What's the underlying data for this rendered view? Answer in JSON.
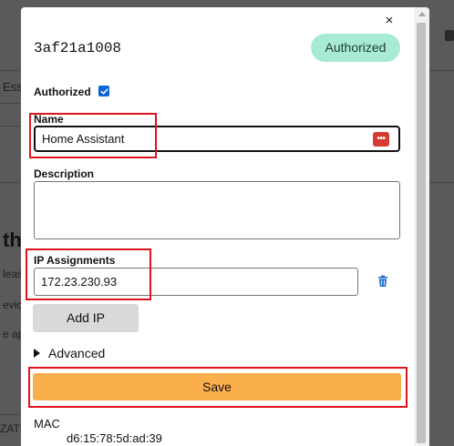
{
  "background_page": {
    "fragments": [
      "Ess",
      "th",
      "leas",
      "evic",
      "e ap",
      "ZATI"
    ]
  },
  "modal": {
    "close_glyph": "×",
    "node_id": "3af21a1008",
    "status_badge": "Authorized",
    "authorized_label": "Authorized",
    "authorized_checked": true,
    "name": {
      "label": "Name",
      "value": "Home Assistant",
      "icon": "password-manager-icon"
    },
    "description": {
      "label": "Description",
      "value": ""
    },
    "ip_assignments": {
      "label": "IP Assignments",
      "value": "172.23.230.93",
      "icon": "trash-icon"
    },
    "add_ip_label": "Add IP",
    "advanced_label": "Advanced",
    "save_label": "Save",
    "mac": {
      "label": "MAC",
      "value": "d6:15:78:5d:ad:39"
    }
  },
  "colors": {
    "badge_bg": "#a7ead5",
    "save_bg": "#fbaf4c",
    "checkbox": "#0a66d6",
    "highlight": "#e0141e",
    "trash": "#1f6fd1"
  }
}
